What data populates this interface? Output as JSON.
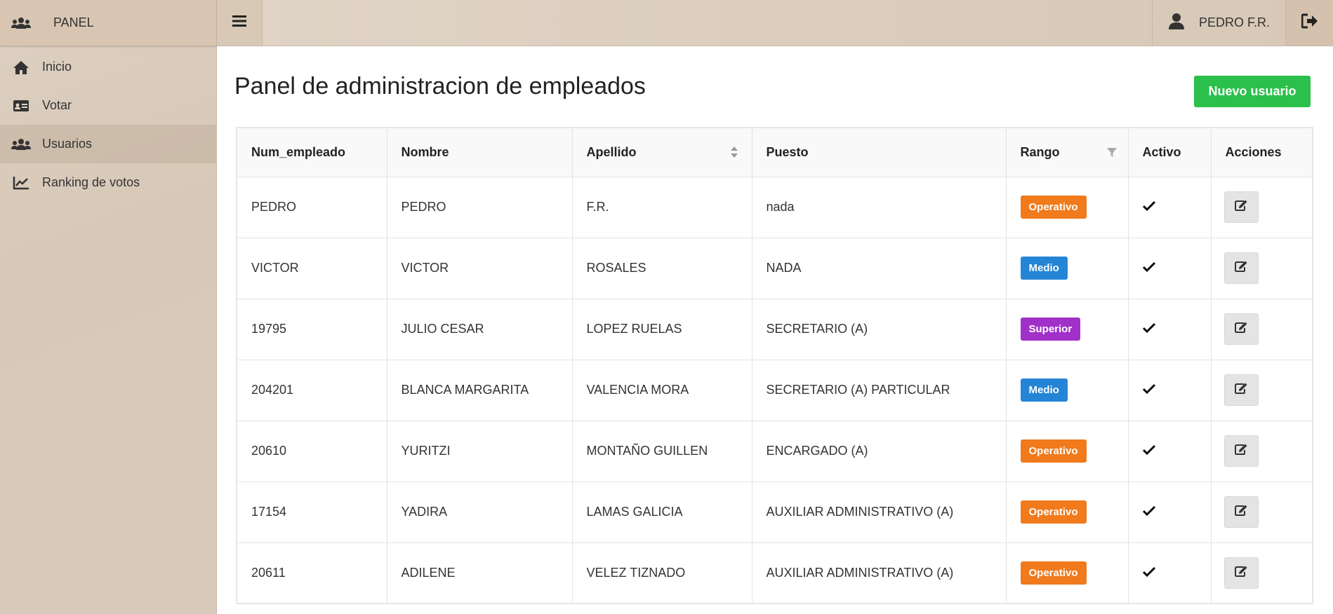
{
  "sidebar": {
    "brand": {
      "label": "PANEL",
      "icon": "users-icon"
    },
    "items": [
      {
        "label": "Inicio",
        "icon": "home-icon",
        "active": false
      },
      {
        "label": "Votar",
        "icon": "id-card-icon",
        "active": false
      },
      {
        "label": "Usuarios",
        "icon": "users-icon",
        "active": true
      },
      {
        "label": "Ranking de votos",
        "icon": "line-chart-icon",
        "active": false
      }
    ]
  },
  "header": {
    "user_name": "PEDRO F.R.",
    "user_icon": "user-icon",
    "logout_icon": "sign-out-icon",
    "menu_icon": "bars-icon"
  },
  "main": {
    "title": "Panel de administracion de empleados",
    "new_button_label": "Nuevo usuario"
  },
  "table": {
    "columns": [
      "Num_empleado",
      "Nombre",
      "Apellido",
      "Puesto",
      "Rango",
      "Activo",
      "Acciones"
    ],
    "rows": [
      {
        "num": "PEDRO",
        "nombre": "PEDRO",
        "apellido": "F.R.",
        "puesto": "nada",
        "rango": "Operativo",
        "activo": true
      },
      {
        "num": "VICTOR",
        "nombre": "VICTOR",
        "apellido": "ROSALES",
        "puesto": "NADA",
        "rango": "Medio",
        "activo": true
      },
      {
        "num": "19795",
        "nombre": "JULIO CESAR",
        "apellido": "LOPEZ RUELAS",
        "puesto": "SECRETARIO (A)",
        "rango": "Superior",
        "activo": true
      },
      {
        "num": "204201",
        "nombre": "BLANCA MARGARITA",
        "apellido": "VALENCIA MORA",
        "puesto": "SECRETARIO (A) PARTICULAR",
        "rango": "Medio",
        "activo": true
      },
      {
        "num": "20610",
        "nombre": "YURITZI",
        "apellido": "MONTAÑO GUILLEN",
        "puesto": "ENCARGADO (A)",
        "rango": "Operativo",
        "activo": true
      },
      {
        "num": "17154",
        "nombre": "YADIRA",
        "apellido": "LAMAS GALICIA",
        "puesto": "AUXILIAR ADMINISTRATIVO (A)",
        "rango": "Operativo",
        "activo": true
      },
      {
        "num": "20611",
        "nombre": "ADILENE",
        "apellido": "VELEZ TIZNADO",
        "puesto": "AUXILIAR ADMINISTRATIVO (A)",
        "rango": "Operativo",
        "activo": true
      }
    ]
  },
  "colors": {
    "Operativo": "#f07a1c",
    "Medio": "#2484d6",
    "Superior": "#a030c8",
    "primary_button": "#2bbf4b"
  }
}
